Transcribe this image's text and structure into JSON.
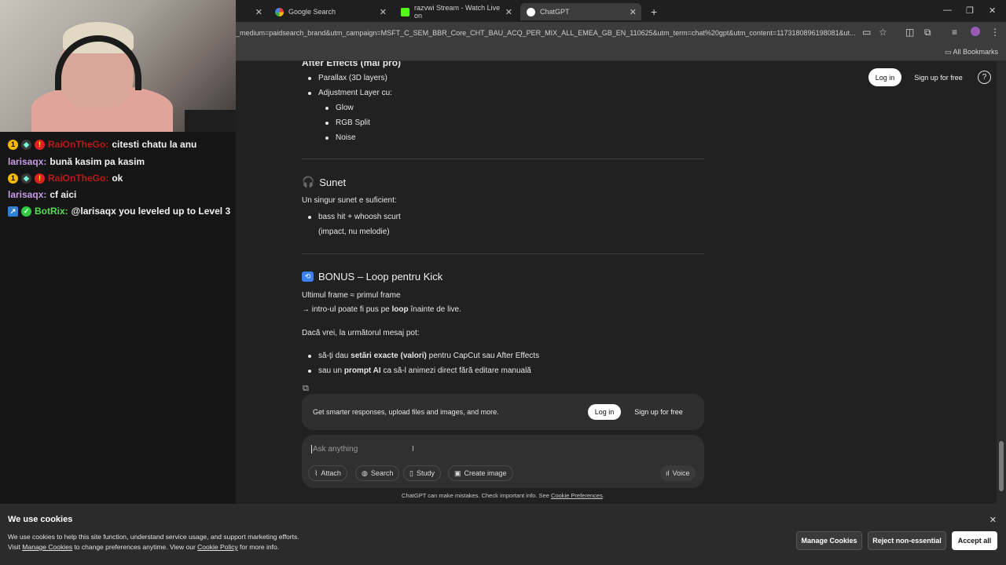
{
  "browser": {
    "tabs": [
      {
        "title": "Google Search"
      },
      {
        "title": "razvwi Stream - Watch Live on"
      },
      {
        "title": "ChatGPT"
      }
    ],
    "url": "_medium=paidsearch_brand&utm_campaign=MSFT_C_SEM_BBR_Core_CHT_BAU_ACQ_PER_MIX_ALL_EMEA_GB_EN_110625&utm_term=chat%20gpt&utm_content=1173180896198081&ut...",
    "bookmarks_label": "All Bookmarks"
  },
  "stream_chat": [
    {
      "user": "RaiOnTheGo:",
      "message": "citesti chatu la anu",
      "color": "#b81a1a"
    },
    {
      "user": "larisaqx:",
      "message": "bună kasim pa kasim",
      "color": "#c89be8"
    },
    {
      "user": "RaiOnTheGo:",
      "message": "ok",
      "color": "#b81a1a"
    },
    {
      "user": "larisaqx:",
      "message": "cf aici",
      "color": "#c89be8"
    },
    {
      "user": "BotRix:",
      "message": "@larisaqx you leveled up to Level 3",
      "color": "#55dd55"
    }
  ],
  "header": {
    "login": "Log in",
    "signup": "Sign up for free",
    "help_icon": "help-icon"
  },
  "article": {
    "partial_heading": "After Effects (mai pro)",
    "ae_items": [
      "Parallax (3D layers)",
      "Adjustment Layer cu:"
    ],
    "ae_subitems": [
      "Glow",
      "RGB Split",
      "Noise"
    ],
    "sound": {
      "heading": "Sunet",
      "intro": "Un singur sunet e suficient:",
      "item_line1": "bass hit + whoosh scurt",
      "item_line2": "(impact, nu melodie)"
    },
    "bonus": {
      "heading": "BONUS – Loop pentru Kick",
      "line1": "Ultimul frame ≈ primul frame",
      "line2_pre": "→ intro-ul poate fi pus pe ",
      "line2_bold": "loop",
      "line2_post": " înainte de live.",
      "offer": "Dacă vrei, la următorul mesaj pot:",
      "opt1_pre": "să-ți dau ",
      "opt1_bold": "setări exacte (valori)",
      "opt1_post": " pentru CapCut sau After Effects",
      "opt2_pre": "sau un ",
      "opt2_bold": "prompt AI",
      "opt2_post": " ca să-l animezi direct fără editare manuală"
    }
  },
  "promo": {
    "text": "Get smarter responses, upload files and images, and more.",
    "login": "Log in",
    "signup": "Sign up for free"
  },
  "composer": {
    "placeholder": "Ask anything",
    "attach": "Attach",
    "search": "Search",
    "study": "Study",
    "create_image": "Create image",
    "voice": "Voice"
  },
  "footer": {
    "text": "ChatGPT can make mistakes. Check important info. See ",
    "link": "Cookie Preferences",
    "end": "."
  },
  "cookies": {
    "title": "We use cookies",
    "line1": "We use cookies to help this site function, understand service usage, and support marketing efforts.",
    "line2_pre": "Visit ",
    "line2_link1": "Manage Cookies",
    "line2_mid": " to change preferences anytime. View our ",
    "line2_link2": "Cookie Policy",
    "line2_post": " for more info.",
    "manage": "Manage Cookies",
    "reject": "Reject non-essential",
    "accept": "Accept all"
  }
}
